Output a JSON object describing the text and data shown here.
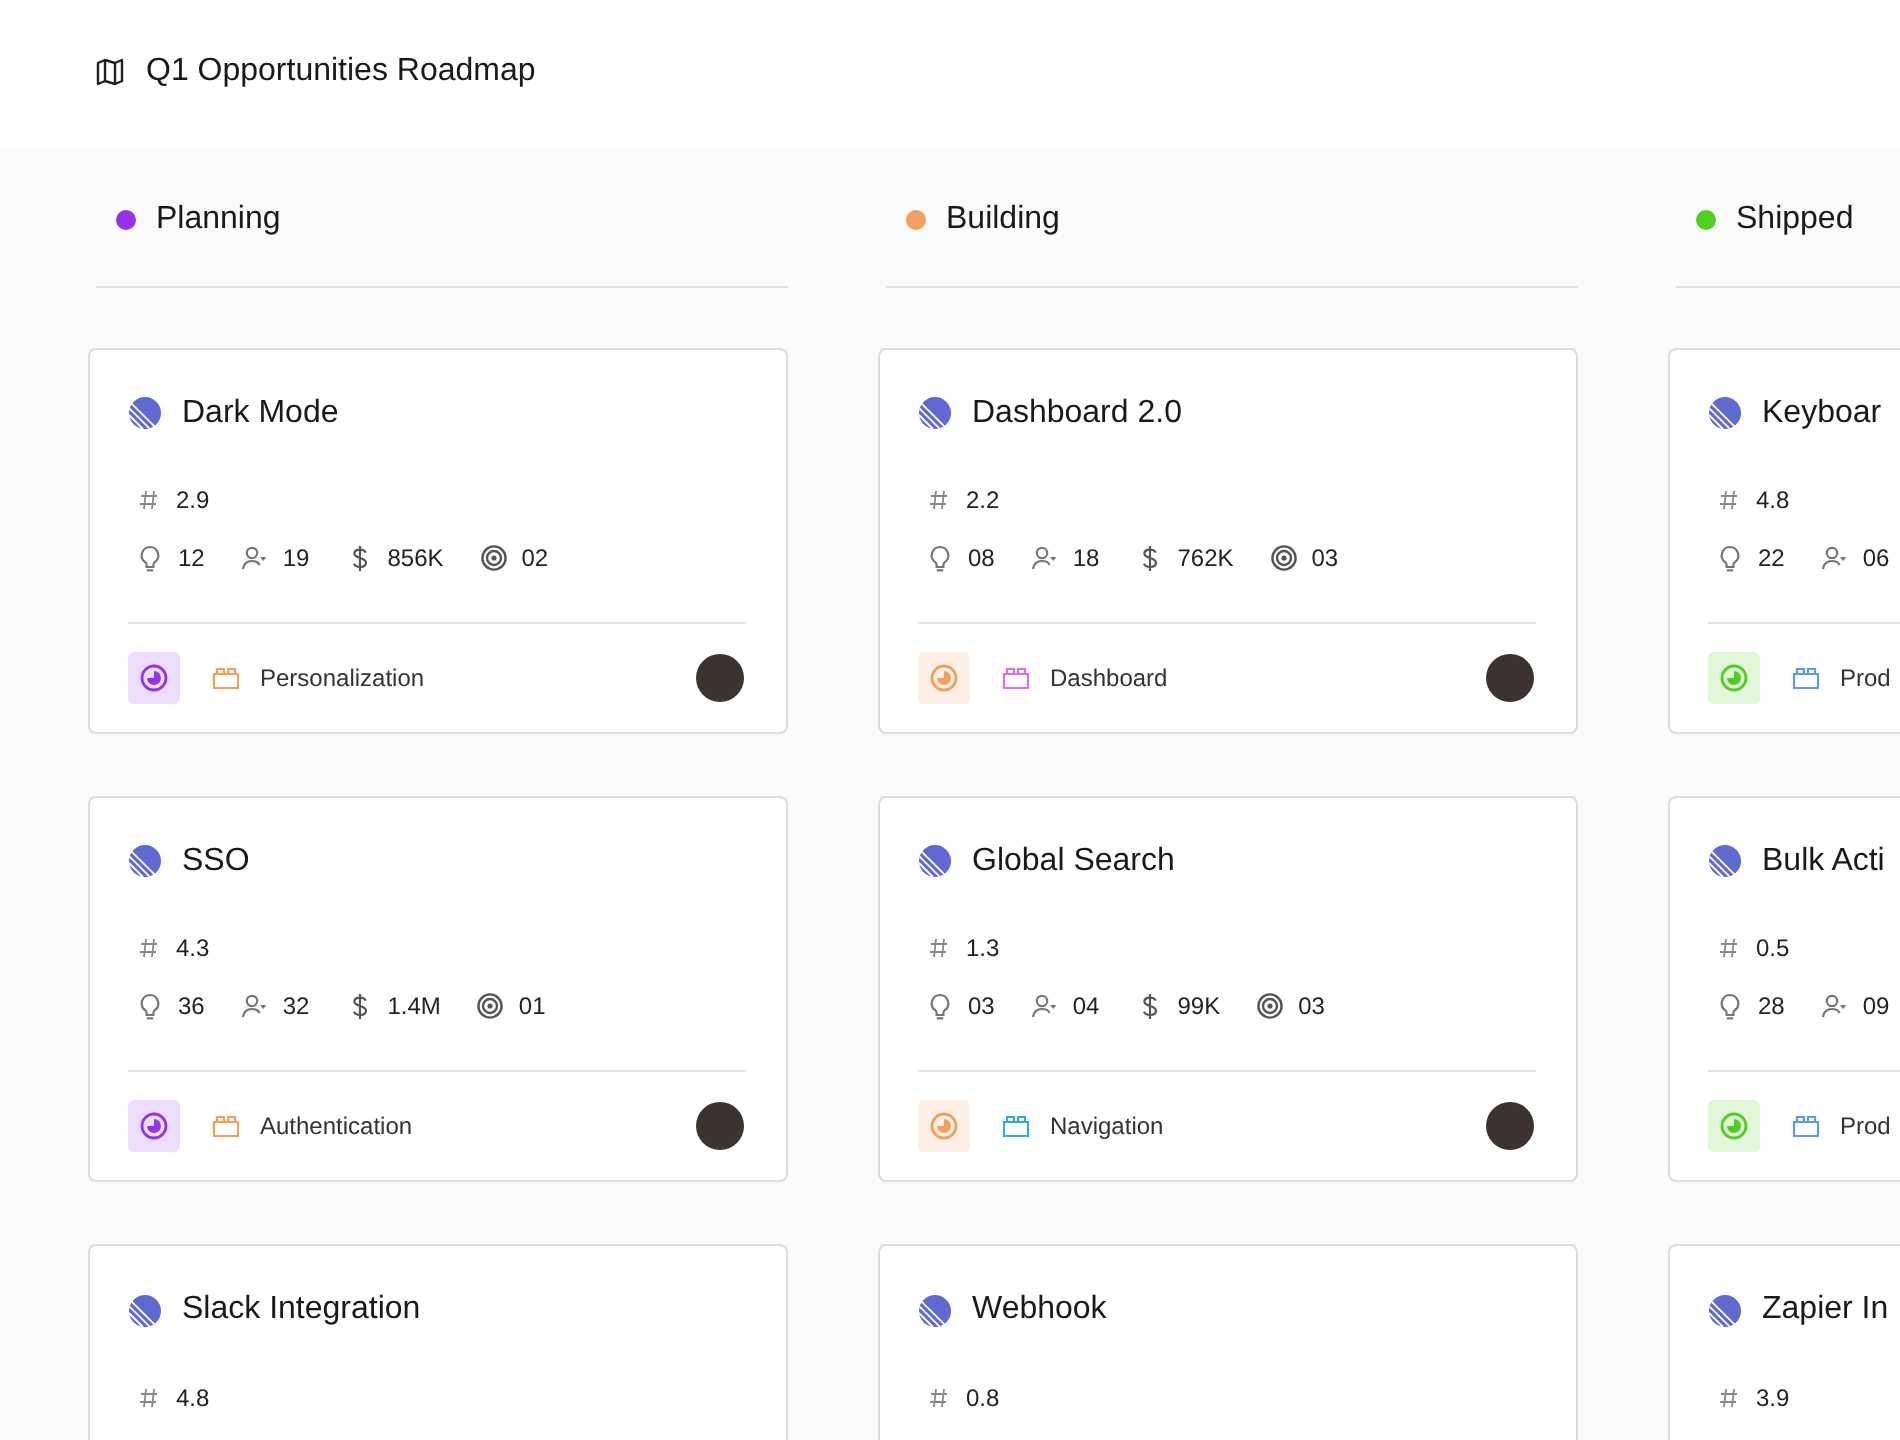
{
  "header": {
    "title": "Q1 Opportunities Roadmap"
  },
  "columns": [
    {
      "name": "Planning",
      "color": "#9333ea",
      "cards": [
        {
          "title": "Dark Mode",
          "score": "2.9",
          "stats": [
            {
              "kind": "ideas",
              "value": "12"
            },
            {
              "kind": "users",
              "value": "19"
            },
            {
              "kind": "revenue",
              "value": "856K"
            },
            {
              "kind": "goals",
              "value": "02"
            }
          ],
          "tag": {
            "label": "Personalization",
            "color": "#f59e5b"
          }
        },
        {
          "title": "SSO",
          "score": "4.3",
          "stats": [
            {
              "kind": "ideas",
              "value": "36"
            },
            {
              "kind": "users",
              "value": "32"
            },
            {
              "kind": "revenue",
              "value": "1.4M"
            },
            {
              "kind": "goals",
              "value": "01"
            }
          ],
          "tag": {
            "label": "Authentication",
            "color": "#f59e5b"
          }
        },
        {
          "title": "Slack Integration",
          "score": "4.8"
        }
      ]
    },
    {
      "name": "Building",
      "color": "#f0a060",
      "cards": [
        {
          "title": "Dashboard 2.0",
          "score": "2.2",
          "stats": [
            {
              "kind": "ideas",
              "value": "08"
            },
            {
              "kind": "users",
              "value": "18"
            },
            {
              "kind": "revenue",
              "value": "762K"
            },
            {
              "kind": "goals",
              "value": "03"
            }
          ],
          "tag": {
            "label": "Dashboard",
            "color": "#d86ef0"
          }
        },
        {
          "title": "Global Search",
          "score": "1.3",
          "stats": [
            {
              "kind": "ideas",
              "value": "03"
            },
            {
              "kind": "users",
              "value": "04"
            },
            {
              "kind": "revenue",
              "value": "99K"
            },
            {
              "kind": "goals",
              "value": "03"
            }
          ],
          "tag": {
            "label": "Navigation",
            "color": "#3ba7d8"
          }
        },
        {
          "title": "Webhook",
          "score": "0.8"
        }
      ]
    },
    {
      "name": "Shipped",
      "color": "#4cd11f",
      "cards": [
        {
          "title": "Keyboar",
          "score": "4.8",
          "stats": [
            {
              "kind": "ideas",
              "value": "22"
            },
            {
              "kind": "users",
              "value": "06"
            }
          ],
          "tag": {
            "label": "Prod",
            "color": "#5b9be0"
          }
        },
        {
          "title": "Bulk Acti",
          "score": "0.5",
          "stats": [
            {
              "kind": "ideas",
              "value": "28"
            },
            {
              "kind": "users",
              "value": "09"
            }
          ],
          "tag": {
            "label": "Prod",
            "color": "#5b9be0"
          }
        },
        {
          "title": "Zapier In",
          "score": "3.9"
        }
      ]
    }
  ]
}
